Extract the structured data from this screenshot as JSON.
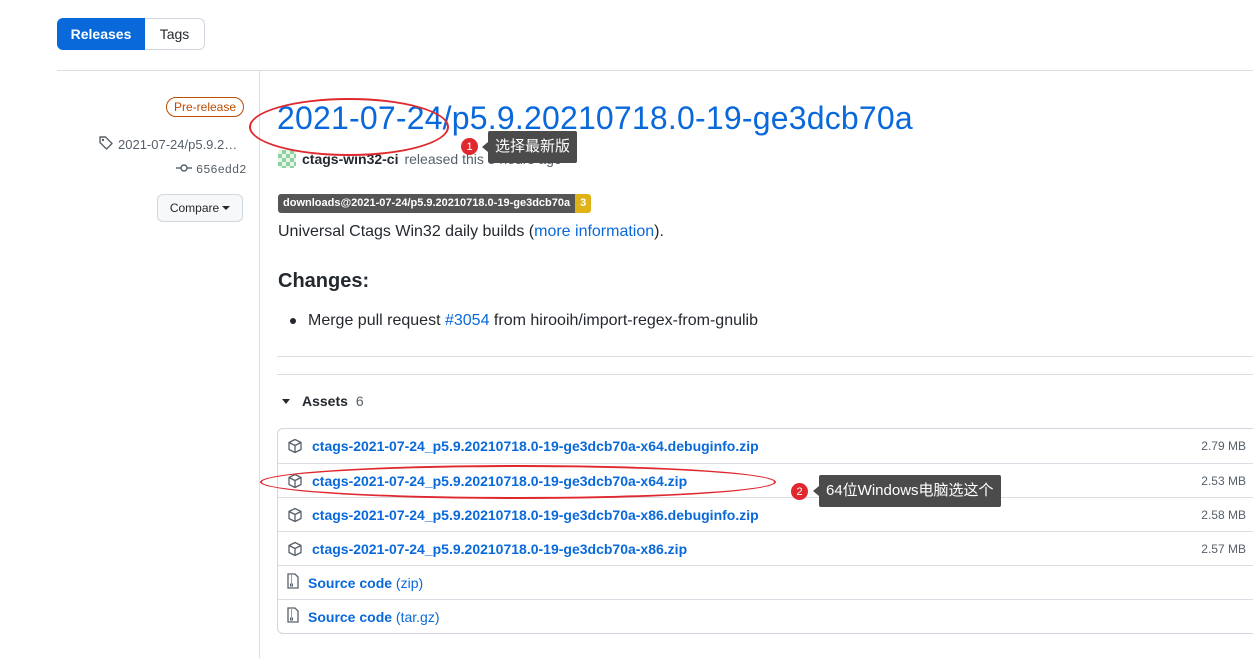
{
  "tabs": [
    {
      "label": "Releases",
      "active": true
    },
    {
      "label": "Tags",
      "active": false
    }
  ],
  "sidebar": {
    "prerelease_label": "Pre-release",
    "tag_label": "2021-07-24/p5.9.2…",
    "commit": "656edd2",
    "compare_label": "Compare"
  },
  "release": {
    "title": "2021-07-24/p5.9.20210718.0-19-ge3dcb70a",
    "author": "ctags-win32-ci",
    "released_text": "released this 3 hours ago",
    "badge_left": "downloads@2021-07-24/p5.9.20210718.0-19-ge3dcb70a",
    "badge_right": "3",
    "description_prefix": "Universal Ctags Win32 daily builds (",
    "description_link": "more information",
    "description_suffix": ").",
    "changes_heading": "Changes:",
    "change_prefix": "Merge pull request ",
    "change_pr": "#3054",
    "change_suffix": " from hirooih/import-regex-from-gnulib"
  },
  "assets": {
    "label": "Assets",
    "count": "6",
    "files": [
      {
        "name": "ctags-2021-07-24_p5.9.20210718.0-19-ge3dcb70a-x64.debuginfo.zip",
        "size": "2.79 MB"
      },
      {
        "name": "ctags-2021-07-24_p5.9.20210718.0-19-ge3dcb70a-x64.zip",
        "size": "2.53 MB"
      },
      {
        "name": "ctags-2021-07-24_p5.9.20210718.0-19-ge3dcb70a-x86.debuginfo.zip",
        "size": "2.58 MB"
      },
      {
        "name": "ctags-2021-07-24_p5.9.20210718.0-19-ge3dcb70a-x86.zip",
        "size": "2.57 MB"
      }
    ],
    "source": [
      {
        "label": "Source code",
        "format": "(zip)"
      },
      {
        "label": "Source code",
        "format": "(tar.gz)"
      }
    ]
  },
  "annotations": {
    "tip1_number": "1",
    "tip1_text": "选择最新版",
    "tip2_number": "2",
    "tip2_text": "64位Windows电脑选这个",
    "highlight_color": "#e0282f"
  }
}
